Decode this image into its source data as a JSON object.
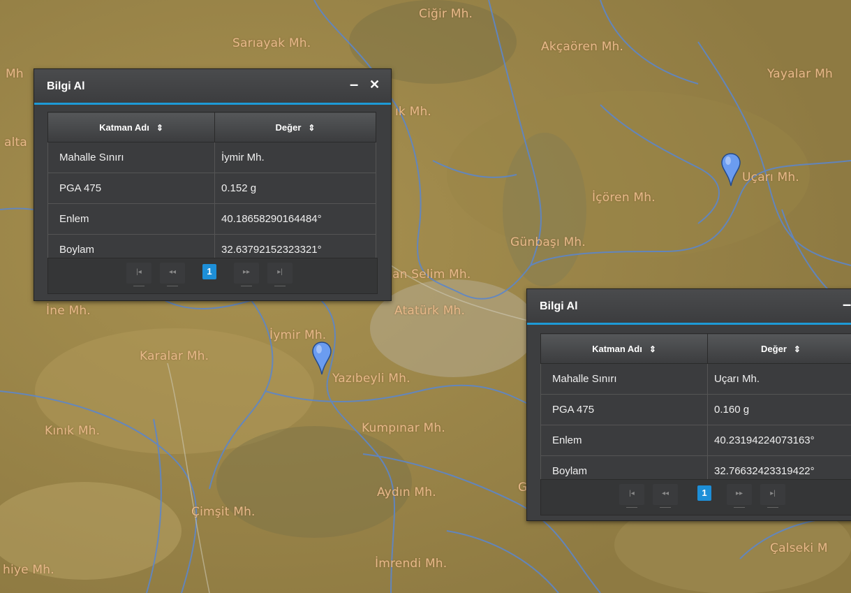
{
  "map": {
    "places": [
      {
        "name": "Sarıayak Mh."
      },
      {
        "name": "Ciğir Mh."
      },
      {
        "name": "Akçaören Mh."
      },
      {
        "name": "Yayalar Mh"
      },
      {
        "name": "Mh"
      },
      {
        "name": "alta"
      },
      {
        "name": "ık Mh."
      },
      {
        "name": "Uçarı Mh."
      },
      {
        "name": "İçören Mh."
      },
      {
        "name": "Günbaşı Mh."
      },
      {
        "name": "an Selim Mh."
      },
      {
        "name": "İne Mh."
      },
      {
        "name": "Atatürk Mh."
      },
      {
        "name": "İymir Mh."
      },
      {
        "name": "Karalar Mh."
      },
      {
        "name": "Yazıbeyli Mh."
      },
      {
        "name": "Kınık Mh."
      },
      {
        "name": "Kumpınar Mh."
      },
      {
        "name": "Aydın Mh."
      },
      {
        "name": "Çimşit Mh."
      },
      {
        "name": "hiye Mh."
      },
      {
        "name": "İmrendi Mh."
      },
      {
        "name": "Çalseki M"
      },
      {
        "name": "G"
      }
    ],
    "marker_color": "#6b9cf0"
  },
  "popups": [
    {
      "title": "Bilgi Al",
      "minimize": "–",
      "close": "✕",
      "columns": [
        "Katman Adı",
        "Değer"
      ],
      "sort_icon": "⇕",
      "rows": [
        [
          "Mahalle Sınırı",
          "İymir Mh."
        ],
        [
          "PGA 475",
          "0.152 g"
        ],
        [
          "Enlem",
          "40.18658290164484°"
        ],
        [
          "Boylam",
          "32.63792152323321°"
        ]
      ],
      "page": "1"
    },
    {
      "title": "Bilgi Al",
      "minimize": "–",
      "columns": [
        "Katman Adı",
        "Değer"
      ],
      "sort_icon": "⇕",
      "rows": [
        [
          "Mahalle Sınırı",
          "Uçarı Mh."
        ],
        [
          "PGA 475",
          "0.160 g"
        ],
        [
          "Enlem",
          "40.23194224073163°"
        ],
        [
          "Boylam",
          "32.76632423319422°"
        ]
      ],
      "page": "1"
    }
  ],
  "pager_icons": [
    "|◂",
    "◂◂",
    "▸▸",
    "▸|"
  ],
  "accent": "#1d9ad6"
}
